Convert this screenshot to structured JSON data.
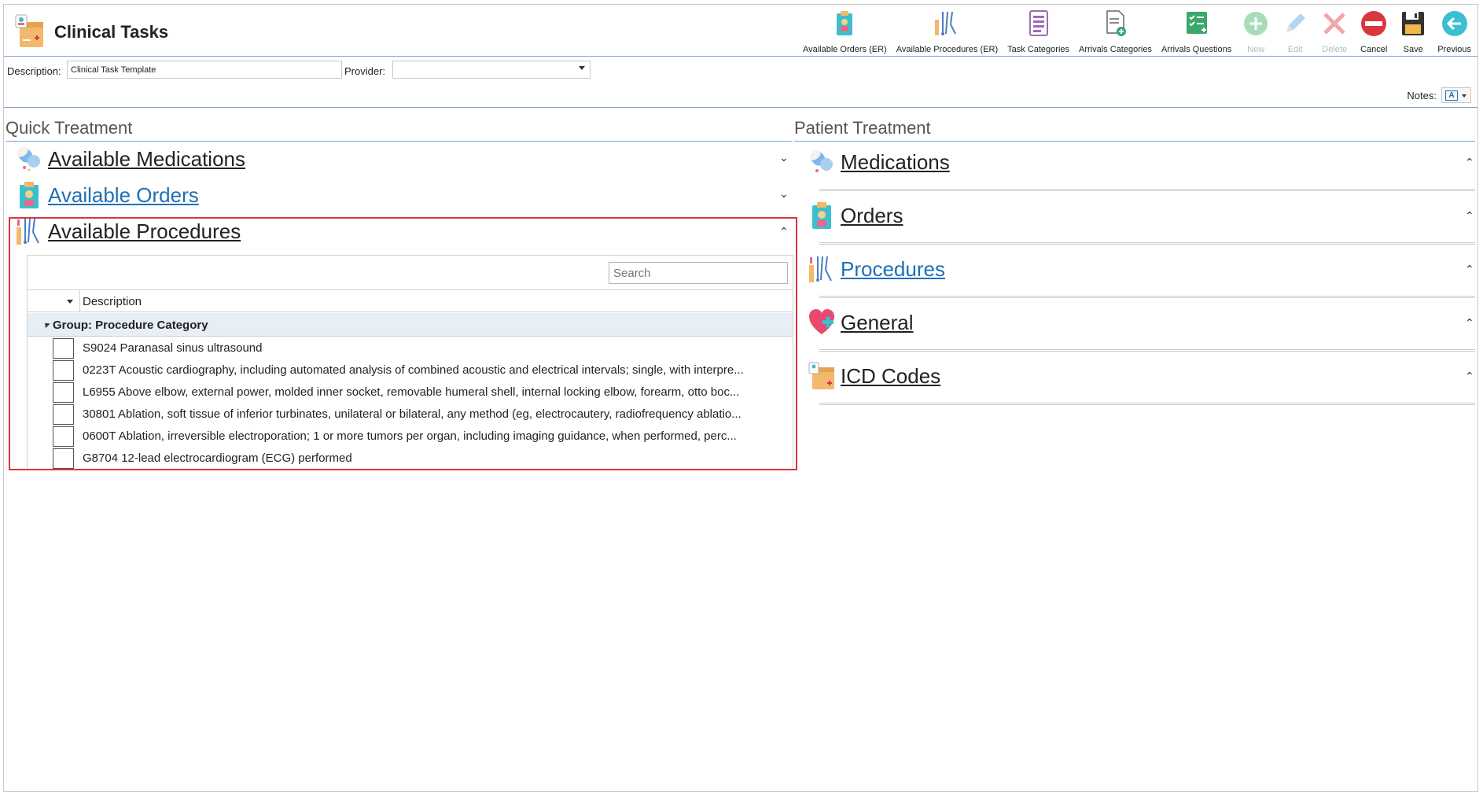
{
  "app": {
    "title": "Clinical Tasks",
    "icon": "clinical-tasks-icon"
  },
  "toolbar": [
    {
      "label": "Available Orders (ER)",
      "icon": "orders-icon",
      "disabled": false
    },
    {
      "label": "Available Procedures (ER)",
      "icon": "procedures-icon",
      "disabled": false
    },
    {
      "label": "Task Categories",
      "icon": "list-icon",
      "disabled": false
    },
    {
      "label": "Arrivals Categories",
      "icon": "document-add-icon",
      "disabled": false
    },
    {
      "label": "Arrivals Questions",
      "icon": "checklist-icon",
      "disabled": false
    },
    {
      "label": "New",
      "icon": "add-icon",
      "disabled": true
    },
    {
      "label": "Edit",
      "icon": "pencil-icon",
      "disabled": true
    },
    {
      "label": "Delete",
      "icon": "delete-x-icon",
      "disabled": true
    },
    {
      "label": "Cancel",
      "icon": "cancel-icon",
      "disabled": false
    },
    {
      "label": "Save",
      "icon": "save-icon",
      "disabled": false
    },
    {
      "label": "Previous",
      "icon": "back-arrow-icon",
      "disabled": false
    }
  ],
  "form": {
    "description_label": "Description:",
    "description_value": "Clinical Task Template",
    "provider_label": "Provider:",
    "provider_value": ""
  },
  "notes": {
    "label": "Notes:"
  },
  "quick_treatment": {
    "title": "Quick Treatment",
    "sections": [
      {
        "title": "Available Medications",
        "icon": "medications-icon",
        "expanded": false,
        "link": false
      },
      {
        "title": "Available Orders",
        "icon": "orders-icon",
        "expanded": false,
        "link": true
      },
      {
        "title": "Available Procedures",
        "icon": "procedures-icon",
        "expanded": true,
        "link": false
      }
    ],
    "procedures_grid": {
      "search_placeholder": "Search",
      "column": "Description",
      "group_label": "Group: Procedure Category",
      "rows": [
        "S9024 Paranasal sinus ultrasound",
        "0223T Acoustic cardiography, including automated analysis of combined acoustic and electrical intervals; single, with interpre...",
        "L6955 Above elbow, external power, molded inner socket, removable humeral shell, internal locking elbow, forearm, otto boc...",
        "30801 Ablation, soft tissue of inferior turbinates, unilateral or bilateral, any method (eg, electrocautery, radiofrequency ablatio...",
        "0600T Ablation, irreversible electroporation; 1 or more tumors per organ, including imaging guidance, when performed, perc...",
        "G8704 12-lead electrocardiogram (ECG) performed"
      ]
    }
  },
  "patient_treatment": {
    "title": "Patient Treatment",
    "sections": [
      {
        "title": "Medications",
        "icon": "medications-icon",
        "link": false
      },
      {
        "title": "Orders",
        "icon": "orders-icon",
        "link": false
      },
      {
        "title": "Procedures",
        "icon": "procedures-icon",
        "link": true
      },
      {
        "title": "General",
        "icon": "heart-plus-icon",
        "link": false
      },
      {
        "title": "ICD Codes",
        "icon": "icd-codes-icon",
        "link": false
      }
    ]
  },
  "colors": {
    "accent": "#7da2ce",
    "link": "#1f6fb5",
    "highlight": "#d9363e",
    "group_bg": "#e8eef6"
  }
}
